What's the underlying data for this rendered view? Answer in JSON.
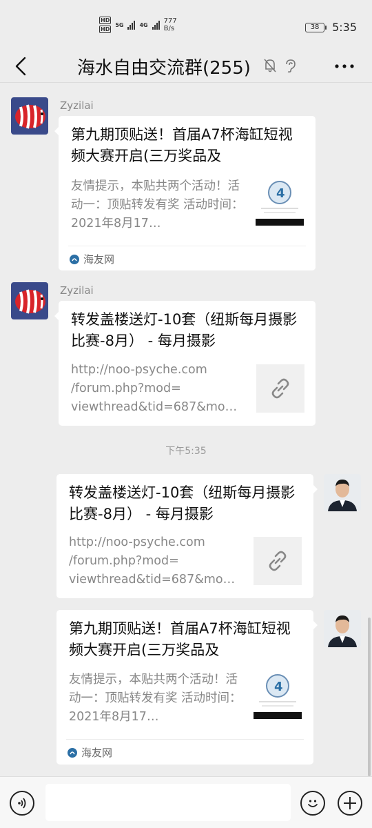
{
  "status_bar": {
    "hd1": "HD",
    "hd2": "HD",
    "net1": "5G",
    "net2": "4G",
    "speed_value": "777",
    "speed_unit": "B/s",
    "battery": "38",
    "time": "5:35"
  },
  "header": {
    "title": "海水自由交流群(255)"
  },
  "messages": [
    {
      "sender": "Zyzilai",
      "title": "第九期顶贴送！首届A7杯海缸短视频大赛开启(三万奖品及",
      "desc": "友情提示，本贴共两个活动！活动一：顶贴转发有奖 活动时间：2021年8月17…",
      "source": "海友网"
    },
    {
      "sender": "Zyzilai",
      "title": "转发盖楼送灯-10套（纽斯每月摄影比赛-8月） - 每月摄影",
      "desc": "http://noo-psyche.com /forum.php?mod= viewthread&tid=687&mo…"
    },
    {
      "title": "转发盖楼送灯-10套（纽斯每月摄影比赛-8月） - 每月摄影",
      "desc": "http://noo-psyche.com /forum.php?mod= viewthread&tid=687&mo…"
    },
    {
      "title": "第九期顶贴送！首届A7杯海缸短视频大赛开启(三万奖品及",
      "desc": "友情提示，本贴共两个活动！活动一：顶贴转发有奖 活动时间：2021年8月17…",
      "source": "海友网"
    }
  ],
  "timestamp": "下午5:35",
  "input": {
    "value": ""
  },
  "colors": {
    "background": "#ededed",
    "card": "#ffffff",
    "link_thumb_bg": "#f0f0f0"
  }
}
